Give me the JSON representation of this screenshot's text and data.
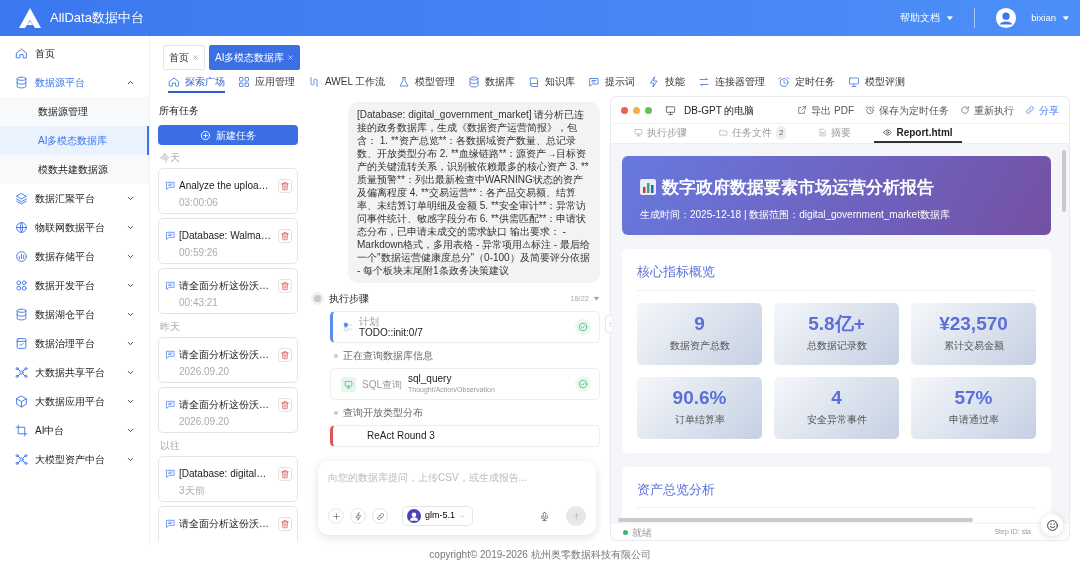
{
  "header": {
    "brand": "AllData数据中台",
    "help": "帮助文档",
    "user": "bixian"
  },
  "sidebar": {
    "items": [
      {
        "kind": "link",
        "label": "首页"
      },
      {
        "kind": "group",
        "label": "数据源平台",
        "expanded": true,
        "children": [
          {
            "label": "数据源管理",
            "selected": false
          },
          {
            "label": "AI多模态数据库",
            "selected": true
          },
          {
            "label": "模数共建数据源",
            "selected": false
          }
        ]
      },
      {
        "kind": "group",
        "label": "数据汇聚平台",
        "expanded": false
      },
      {
        "kind": "group",
        "label": "物联网数据平台",
        "expanded": false
      },
      {
        "kind": "group",
        "label": "数据存储平台",
        "expanded": false
      },
      {
        "kind": "group",
        "label": "数据开发平台",
        "expanded": false
      },
      {
        "kind": "group",
        "label": "数据湖仓平台",
        "expanded": false
      },
      {
        "kind": "group",
        "label": "数据治理平台",
        "expanded": false
      },
      {
        "kind": "group",
        "label": "大数据共享平台",
        "expanded": false
      },
      {
        "kind": "group",
        "label": "大数据应用平台",
        "expanded": false
      },
      {
        "kind": "group",
        "label": "AI中台",
        "expanded": false
      },
      {
        "kind": "group",
        "label": "大模型资产中台",
        "expanded": false
      }
    ]
  },
  "page_tabs": [
    {
      "label": "首页",
      "selected": false
    },
    {
      "label": "AI多模态数据库",
      "selected": true
    }
  ],
  "nav": [
    {
      "label": "探索广场",
      "selected": true
    },
    {
      "label": "应用管理",
      "selected": false
    },
    {
      "label": "AWEL 工作流",
      "selected": false
    },
    {
      "label": "模型管理",
      "selected": false
    },
    {
      "label": "数据库",
      "selected": false
    },
    {
      "label": "知识库",
      "selected": false
    },
    {
      "label": "提示词",
      "selected": false
    },
    {
      "label": "技能",
      "selected": false
    },
    {
      "label": "连接器管理",
      "selected": false
    },
    {
      "label": "定时任务",
      "selected": false
    },
    {
      "label": "模型评测",
      "selected": false
    }
  ],
  "tasks": {
    "title": "所有任务",
    "new_button": "新建任务",
    "groups": [
      {
        "label": "今天",
        "items": [
          {
            "title": "Analyze the uploa…",
            "time": "03:00:06"
          },
          {
            "title": "[Database: Walma…",
            "time": "00:59:26"
          },
          {
            "title": "请全面分析这份沃…",
            "time": "00:43:21"
          }
        ]
      },
      {
        "label": "昨天",
        "items": [
          {
            "title": "请全面分析这份沃…",
            "time": "2026.09.20"
          },
          {
            "title": "请全面分析这份沃…",
            "time": "2026.09.20"
          }
        ]
      },
      {
        "label": "以往",
        "items": [
          {
            "title": "[Database: digital…",
            "time": "3天前"
          },
          {
            "title": "请全面分析这份沃…"
          }
        ]
      }
    ]
  },
  "chat": {
    "message": "[Database: digital_government_market] 请分析已连接的政务数据库，生成《数据资产运营简报》，包含： 1. **资产总览**：各数据域资产数量、总记录数、开放类型分布 2. **血缘链路**：源资产→目标资产的关键流转关系，识别被依赖最多的核心资产 3. **质量预警**：列出最新检查中WARNING状态的资产及偏离程度 4. **交易运营**：各产品交易额、结算率、未结算订单明细及金额 5. **安全审计**：异常访问事件统计、敏感字段分布 6. **供需匹配**：申请状态分布，已申请未成交的需求缺口 输出要求： - Markdown格式，多用表格 - 异常项用⚠标注 - 最后给一个\"数据运营健康度总分\"（0-100）及简要评分依据 - 每个板块末尾附1条政务决策建议",
    "steps": {
      "title": "执行步骤",
      "count": "18/22",
      "items": [
        {
          "kind": "plan",
          "tag": "计划",
          "title": "TODO::init:0/7",
          "done": true
        },
        {
          "kind": "note",
          "text": "正在查询数据库信息"
        },
        {
          "kind": "tool",
          "tag": "SQL查询",
          "title": "sql_query",
          "subtitle": "Thought/Action/Observation",
          "done": true
        },
        {
          "kind": "note",
          "text": "查询开放类型分布"
        },
        {
          "kind": "round",
          "title": "ReAct Round 3"
        }
      ]
    },
    "input": {
      "placeholder": "向您的数据库提问，上传CSV，或生成报告...",
      "model": "glm-5.1"
    }
  },
  "workspace": {
    "title": "DB-GPT 的电脑",
    "actions": [
      {
        "kind": "export",
        "label": "导出 PDF"
      },
      {
        "kind": "schedule",
        "label": "保存为定时任务"
      },
      {
        "kind": "rerun",
        "label": "重新执行"
      },
      {
        "kind": "share",
        "label": "分享"
      }
    ],
    "tabs": [
      {
        "label": "执行步骤",
        "selected": false
      },
      {
        "label": "任务文件",
        "badge": "2",
        "selected": false
      },
      {
        "label": "摘要",
        "selected": false
      },
      {
        "label": "Report.html",
        "selected": true
      }
    ],
    "report": {
      "title": "数字政府数据要素市场运营分析报告",
      "subtitle": "生成时间：2025-12-18 | 数据范围：digital_government_market数据库",
      "sections": [
        {
          "heading": "核心指标概览",
          "metrics": [
            {
              "value": "9",
              "label": "数据资产总数"
            },
            {
              "value": "5.8亿+",
              "label": "总数据记录数"
            },
            {
              "value": "¥23,570",
              "label": "累计交易金额"
            },
            {
              "value": "90.6%",
              "label": "订单结算率"
            },
            {
              "value": "4",
              "label": "安全异常事件"
            },
            {
              "value": "57%",
              "label": "申请通过率"
            }
          ]
        },
        {
          "heading": "资产总览分析"
        }
      ]
    },
    "status": "就绪",
    "step_id": "Step ID: sta"
  },
  "footer": "copyright© 2019-2026 杭州奥零数据科技有限公司"
}
